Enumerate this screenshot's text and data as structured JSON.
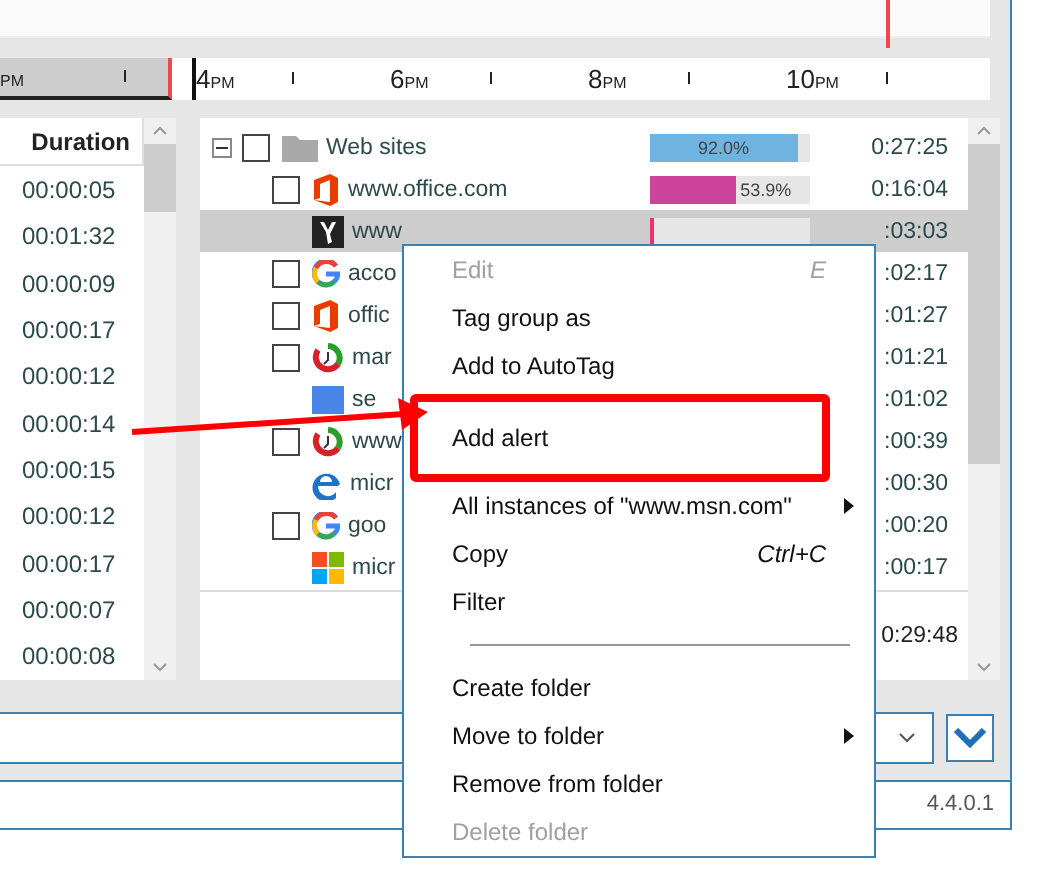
{
  "ruler": {
    "labels": [
      {
        "suffix": "PM"
      },
      {
        "hour": "4",
        "suffix": "PM"
      },
      {
        "hour": "6",
        "suffix": "PM"
      },
      {
        "hour": "8",
        "suffix": "PM"
      },
      {
        "hour": "10",
        "suffix": "PM"
      }
    ]
  },
  "durations": {
    "header": "Duration",
    "values": [
      "00:00:05",
      "00:01:32",
      "00:00:09",
      "00:00:17",
      "00:00:12",
      "00:00:14",
      "00:00:15",
      "00:00:12",
      "00:00:17",
      "00:00:07",
      "00:00:08"
    ]
  },
  "tree": {
    "items": [
      {
        "name": "Web sites",
        "kind": "folder",
        "checked": false,
        "expanded": true,
        "selected": false,
        "bar": {
          "level": 0.92,
          "label": "92.0%",
          "color": "#6fb3e0"
        },
        "time": "0:27:25",
        "children": [
          {
            "name": "www.office.com",
            "kind": "office",
            "checked": false,
            "selected": false,
            "bar": {
              "level": 0.539,
              "label": "53.9%",
              "color": "#cc4499"
            },
            "time": "0:16:04"
          },
          {
            "name": "www",
            "kind": "app",
            "selected": true,
            "bar": {
              "level": 0.03,
              "color": "#e8336e"
            },
            "time": ":03:03"
          },
          {
            "name": "acco",
            "kind": "google",
            "checked": false,
            "selected": false,
            "time": ":02:17"
          },
          {
            "name": "offic",
            "kind": "office",
            "checked": false,
            "selected": false,
            "time": ":01:27"
          },
          {
            "name": "mar",
            "kind": "timer",
            "checked": false,
            "selected": false,
            "time": ":01:21"
          },
          {
            "name": "se",
            "kind": "block",
            "selected": false,
            "time": ":01:02"
          },
          {
            "name": "www",
            "kind": "timer",
            "checked": false,
            "selected": false,
            "time": ":00:39"
          },
          {
            "name": "micr",
            "kind": "edge",
            "selected": false,
            "time": ":00:30"
          },
          {
            "name": "goo",
            "kind": "google",
            "checked": false,
            "selected": false,
            "time": ":00:20"
          },
          {
            "name": "micr",
            "kind": "tiles",
            "selected": false,
            "time": ":00:17"
          }
        ]
      }
    ],
    "total": "0:29:48"
  },
  "version": "4.4.0.1",
  "context_menu": {
    "items": [
      {
        "kind": "item",
        "label": "Edit",
        "shortcut": "E",
        "disabled": true,
        "submenu": false,
        "highlighted": false
      },
      {
        "kind": "item",
        "label": "Tag group as",
        "disabled": false,
        "submenu": false,
        "highlighted": false
      },
      {
        "kind": "item",
        "label": "Add to AutoTag",
        "disabled": false,
        "submenu": false,
        "highlighted": false
      },
      {
        "kind": "item",
        "label": "Add alert",
        "disabled": false,
        "submenu": false,
        "highlighted": true
      },
      {
        "kind": "item",
        "label": "All instances of \"www.msn.com\"",
        "disabled": false,
        "submenu": true,
        "highlighted": false
      },
      {
        "kind": "item",
        "label": "Copy",
        "shortcut": "Ctrl+C",
        "disabled": false,
        "submenu": false,
        "highlighted": false
      },
      {
        "kind": "item",
        "label": "Filter",
        "disabled": false,
        "submenu": false,
        "highlighted": false
      },
      {
        "kind": "separator"
      },
      {
        "kind": "item",
        "label": "Create folder",
        "disabled": false,
        "submenu": false,
        "highlighted": false
      },
      {
        "kind": "item",
        "label": "Move to folder",
        "disabled": false,
        "submenu": true,
        "highlighted": false
      },
      {
        "kind": "item",
        "label": "Remove from folder",
        "disabled": false,
        "submenu": false,
        "highlighted": false
      },
      {
        "kind": "item",
        "label": "Delete folder",
        "disabled": true,
        "submenu": false,
        "highlighted": false
      }
    ]
  }
}
